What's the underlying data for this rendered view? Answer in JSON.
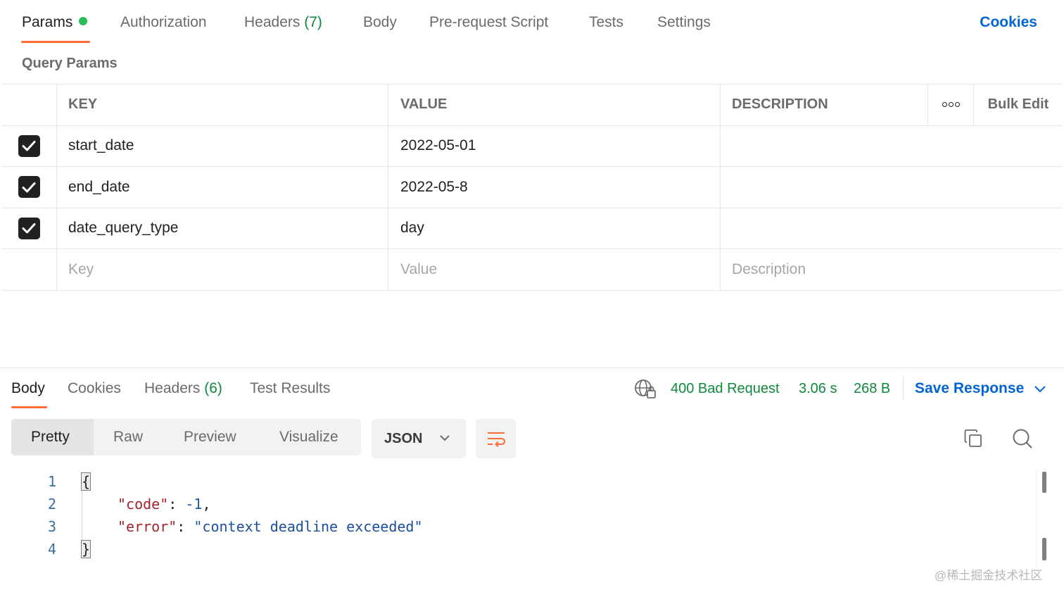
{
  "request_tabs": {
    "params": "Params",
    "authorization": "Authorization",
    "headers": "Headers",
    "headers_count": "(7)",
    "body": "Body",
    "pre_request": "Pre-request Script",
    "tests": "Tests",
    "settings": "Settings",
    "cookies": "Cookies"
  },
  "query_params": {
    "title": "Query Params",
    "columns": {
      "key": "KEY",
      "value": "VALUE",
      "description": "DESCRIPTION",
      "bulk_edit": "Bulk Edit"
    },
    "rows": [
      {
        "checked": true,
        "key": "start_date",
        "value": "2022-05-01",
        "description": ""
      },
      {
        "checked": true,
        "key": "end_date",
        "value": "2022-05-8",
        "description": ""
      },
      {
        "checked": true,
        "key": "date_query_type",
        "value": "day",
        "description": ""
      }
    ],
    "placeholders": {
      "key": "Key",
      "value": "Value",
      "description": "Description"
    }
  },
  "response": {
    "tabs": {
      "body": "Body",
      "cookies": "Cookies",
      "headers": "Headers",
      "headers_count": "(6)",
      "test_results": "Test Results"
    },
    "status": "400 Bad Request",
    "time": "3.06 s",
    "size": "268 B",
    "save_response": "Save Response",
    "view_modes": {
      "pretty": "Pretty",
      "raw": "Raw",
      "preview": "Preview",
      "visualize": "Visualize"
    },
    "format": "JSON",
    "code_lines": {
      "l1": {
        "num": "1",
        "brace": "{"
      },
      "l2": {
        "num": "2",
        "key": "\"code\"",
        "sep": ": ",
        "value": "-1",
        "trail": ","
      },
      "l3": {
        "num": "3",
        "key": "\"error\"",
        "sep": ": ",
        "value": "\"context deadline exceeded\""
      },
      "l4": {
        "num": "4",
        "brace": "}"
      }
    }
  },
  "watermark": "@稀土掘金技术社区",
  "colors": {
    "accent_orange": "#ff6c37",
    "link_blue": "#0265d2",
    "status_green": "#0f8a3c",
    "dot_green": "#2dbc5a"
  }
}
